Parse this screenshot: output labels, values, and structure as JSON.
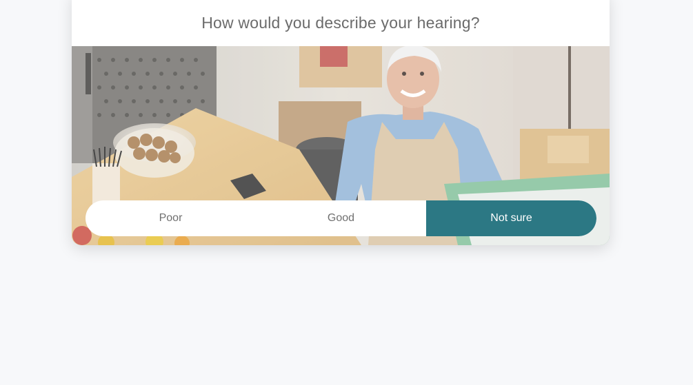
{
  "survey": {
    "question": "How would you describe your hearing?",
    "options": [
      "Poor",
      "Good",
      "Not sure"
    ],
    "selected_option": "Not sure",
    "photo_subject": "smiling-woman-in-apron-at-cafe-counter"
  },
  "colors": {
    "accent": "#2c7884",
    "background": "#f7f8fa",
    "card": "#ffffff",
    "question_text": "#6b6b6b"
  }
}
